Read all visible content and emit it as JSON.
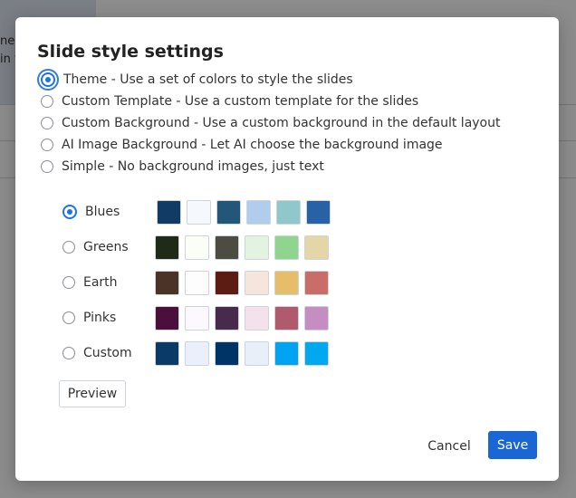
{
  "background": {
    "snippet_lines": [
      "to",
      "ne",
      "in t"
    ]
  },
  "dialog": {
    "title": "Slide style settings",
    "style_options": [
      {
        "label": "Theme - Use a set of colors to style the slides",
        "selected": true
      },
      {
        "label": "Custom Template - Use a custom template for the slides",
        "selected": false
      },
      {
        "label": "Custom Background - Use a custom background in the default layout",
        "selected": false
      },
      {
        "label": "AI Image Background - Let AI choose the background image",
        "selected": false
      },
      {
        "label": "Simple - No background images, just text",
        "selected": false
      }
    ],
    "themes": [
      {
        "label": "Blues",
        "selected": true,
        "colors": [
          "#0f3b64",
          "#f5f9fd",
          "#22577a",
          "#b1cdee",
          "#8fc7ca",
          "#2762a6"
        ]
      },
      {
        "label": "Greens",
        "selected": false,
        "colors": [
          "#1f2b17",
          "#fbfdf7",
          "#4c4c40",
          "#e2f3df",
          "#90d58d",
          "#e4d6a6"
        ]
      },
      {
        "label": "Earth",
        "selected": false,
        "colors": [
          "#4a3428",
          "#fdfdfd",
          "#5c1b13",
          "#f6e5dd",
          "#e6be6a",
          "#c96d68"
        ]
      },
      {
        "label": "Pinks",
        "selected": false,
        "colors": [
          "#4a0f3a",
          "#fbf9fd",
          "#482a4c",
          "#f3e1ec",
          "#b05a6e",
          "#c48ec2"
        ]
      },
      {
        "label": "Custom",
        "selected": false,
        "colors": [
          "#0a3a68",
          "#eaf0fb",
          "#003366",
          "#e9eff9",
          "#00a2f2",
          "#00a8ef"
        ]
      }
    ],
    "preview_label": "Preview",
    "cancel_label": "Cancel",
    "save_label": "Save"
  }
}
